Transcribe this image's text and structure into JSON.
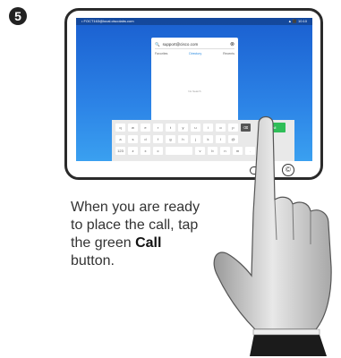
{
  "step_number": "5",
  "screen": {
    "status_left": "• FOCT163@local.ciscolabs.com",
    "status_right": "▲ ⬛ 10:10",
    "search_value": "support@cisco.com",
    "tabs": [
      "Favorites",
      "Directory",
      "Recents"
    ],
    "empty_message": "No Search"
  },
  "keyboard": {
    "row1": [
      "q",
      "w",
      "e",
      "r",
      "t",
      "y",
      "u",
      "i",
      "o",
      "p"
    ],
    "row2": [
      "a",
      "s",
      "d",
      "f",
      "g",
      "h",
      "j",
      "k",
      "l",
      "@"
    ],
    "row3": [
      "123",
      "z",
      "x",
      "c",
      "v",
      "b",
      "n",
      "m",
      ".",
      "com"
    ],
    "call_label": "Call"
  },
  "caption": {
    "line_prefix": "When you are ready to place the call, tap the green ",
    "bold_word": "Call",
    "line_suffix": " button."
  }
}
